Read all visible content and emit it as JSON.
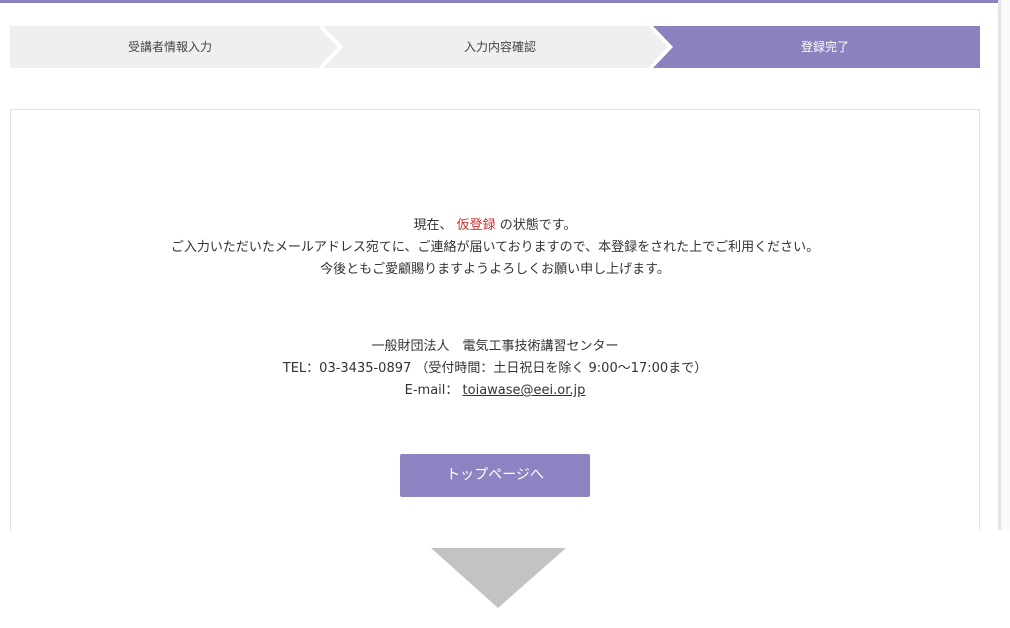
{
  "steps": [
    {
      "label": "受講者情報入力",
      "active": false
    },
    {
      "label": "入力内容確認",
      "active": false
    },
    {
      "label": "登録完了",
      "active": true
    }
  ],
  "colors": {
    "accent": "#8a82bf",
    "inactive_step": "#efefef",
    "highlight": "#cc3333"
  },
  "message": {
    "line1_prefix": "現在、",
    "line1_highlight": "仮登録",
    "line1_suffix": "の状態です。",
    "line2": "ご入力いただいたメールアドレス宛てに、ご連絡が届いておりますので、本登録をされた上でご利用ください。",
    "line3": "今後ともご愛顧賜りますようよろしくお願い申し上げます。"
  },
  "contact": {
    "org": "一般財団法人　電気工事技術講習センター",
    "tel": "TEL：03-3435-0897 （受付時間：土日祝日を除く 9:00～17:00まで）",
    "email_label": "E-mail：",
    "email": "toiawase@eei.or.jp"
  },
  "button": {
    "top_page": "トップページへ"
  },
  "icons": {
    "down_arrow": "triangle-down"
  }
}
